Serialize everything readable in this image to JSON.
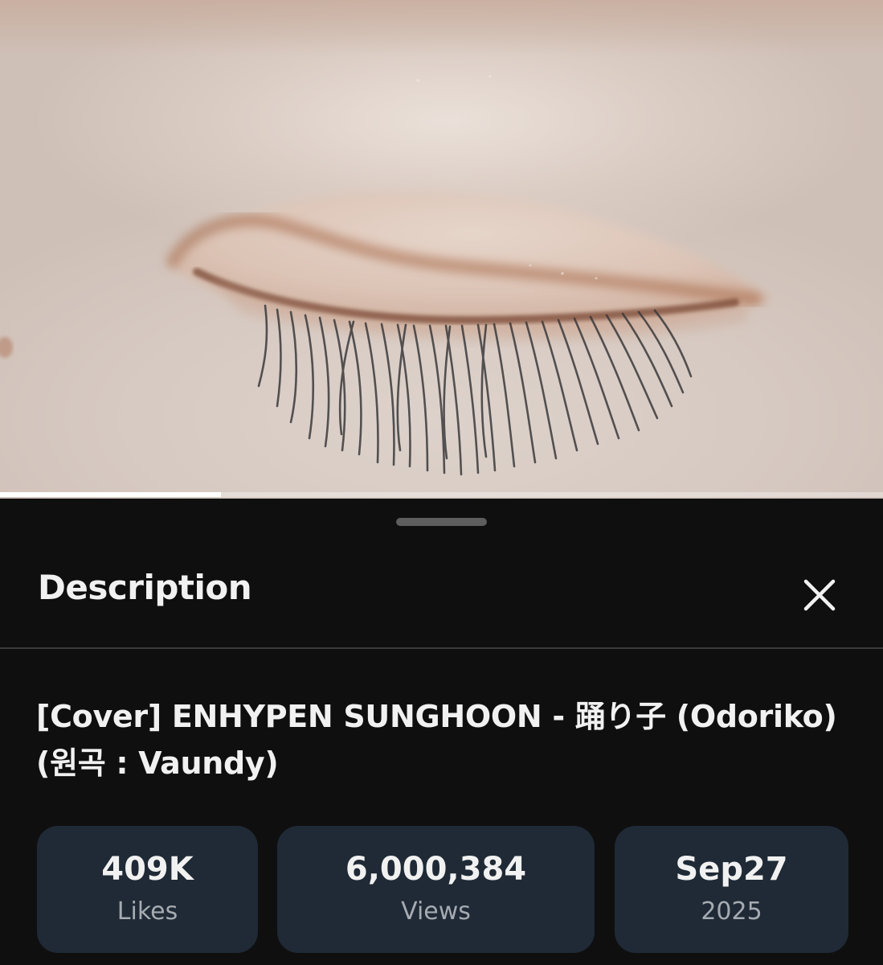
{
  "video": {
    "thumbnail_subject": "closed-eye-closeup-image",
    "progress_fraction": 0.25
  },
  "sheet": {
    "title": "Description",
    "close_icon": "close-icon",
    "handle_icon": "drag-handle"
  },
  "video_info": {
    "title": "[Cover] ENHYPEN SUNGHOON - 踊り子 (Odoriko) (원곡 : Vaundy)"
  },
  "stats": {
    "likes": {
      "value": "409K",
      "label": "Likes"
    },
    "views": {
      "value": "6,000,384",
      "label": "Views"
    },
    "date": {
      "value": "Sep27",
      "label": "2025"
    }
  },
  "colors": {
    "sheet_bg": "#0f0f0f",
    "stat_bg": "#1f2a36",
    "text_primary": "#f1f1f1",
    "text_secondary": "#a6abb1"
  }
}
